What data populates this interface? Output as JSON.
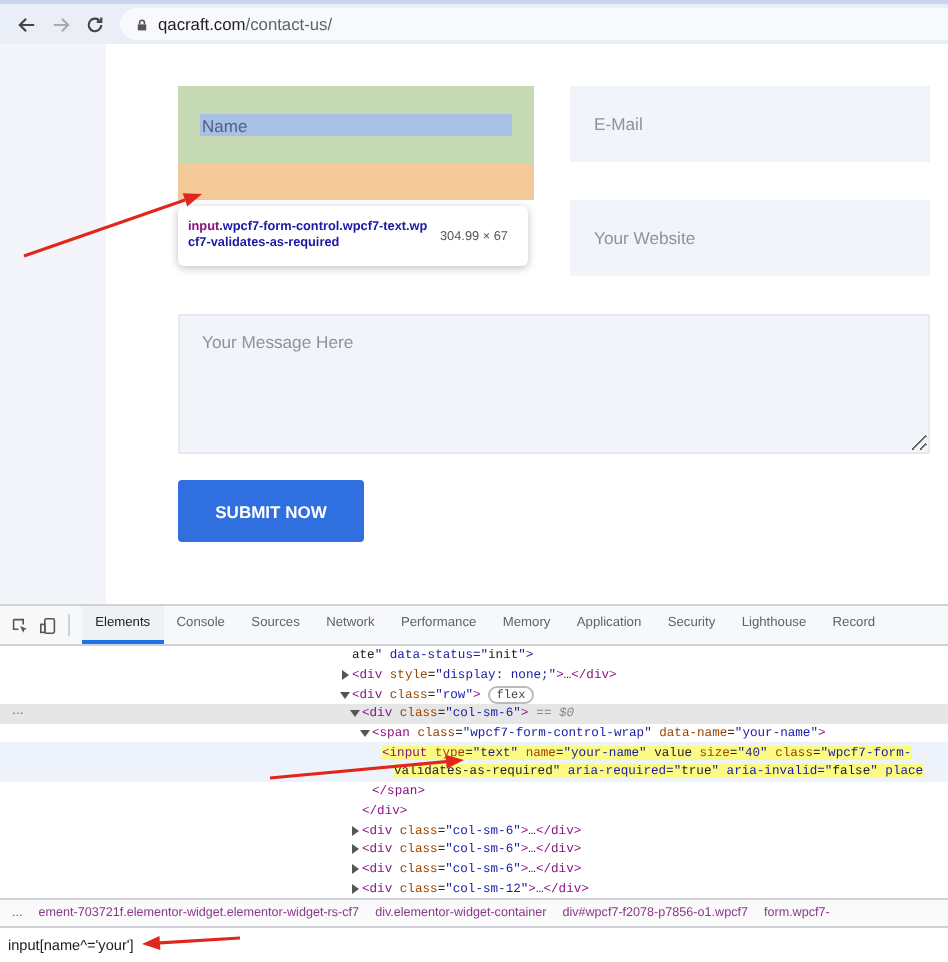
{
  "browser": {
    "url_host": "qacraft.com",
    "url_path": "/contact-us/"
  },
  "form": {
    "name": {
      "placeholder": "Name"
    },
    "tooltip": {
      "tag": "input",
      "classes": ".wpcf7-form-control.wpcf7-text.wpcf7-validates-as-required",
      "size": "304.99 × 67"
    },
    "email": {
      "placeholder": "E-Mail"
    },
    "website": {
      "placeholder": "Your Website"
    },
    "message": {
      "placeholder": "Your Message Here"
    },
    "submit": "SUBMIT NOW"
  },
  "devtools": {
    "tabs": [
      {
        "label": "Elements",
        "selected": true
      },
      {
        "label": "Console",
        "selected": false
      },
      {
        "label": "Sources",
        "selected": false
      },
      {
        "label": "Network",
        "selected": false
      },
      {
        "label": "Performance",
        "selected": false
      },
      {
        "label": "Memory",
        "selected": false
      },
      {
        "label": "Application",
        "selected": false
      },
      {
        "label": "Security",
        "selected": false
      },
      {
        "label": "Lighthouse",
        "selected": false
      },
      {
        "label": "Record",
        "selected": false
      }
    ],
    "tree": [
      {
        "lines": [
          "ate\" data-status=\"init\">"
        ],
        "selected": false,
        "highlighted": false
      },
      {
        "lines": [
          "<div style=\"display: none;\">…</div>"
        ],
        "expanded": false,
        "selected": false,
        "highlighted": false
      },
      {
        "lines": [
          "<div class=\"row\">"
        ],
        "badge": "flex",
        "expanded": true,
        "selected": false,
        "highlighted": false,
        "children": [
          {
            "lines": [
              "<div class=\"col-sm-6\">"
            ],
            "suffix": "== $0",
            "gutter": "...",
            "expanded": true,
            "selected": true,
            "highlighted": false,
            "close": "</div>",
            "children": [
              {
                "lines": [
                  "<span class=\"wpcf7-form-control-wrap\" data-name=\"your-name\">"
                ],
                "expanded": true,
                "selected": false,
                "highlighted": false,
                "close": "</span>",
                "children": [
                  {
                    "lines": [
                      "<input type=\"text\" name=\"your-name\" value size=\"40\" class=\"wpcf7-form-",
                      "validates-as-required\" aria-required=\"true\" aria-invalid=\"false\" place"
                    ],
                    "selected": false,
                    "highlighted": true
                  }
                ]
              }
            ]
          },
          {
            "lines": [
              "<div class=\"col-sm-6\">…</div>"
            ],
            "expanded": false,
            "selected": false,
            "highlighted": false
          },
          {
            "lines": [
              "<div class=\"col-sm-6\">…</div>"
            ],
            "expanded": false,
            "selected": false,
            "highlighted": false
          },
          {
            "lines": [
              "<div class=\"col-sm-6\">…</div>"
            ],
            "expanded": false,
            "selected": false,
            "highlighted": false
          },
          {
            "lines": [
              "<div class=\"col-sm-12\">…</div>"
            ],
            "expanded": false,
            "selected": false,
            "highlighted": false
          }
        ]
      }
    ],
    "breadcrumbs": {
      "overflow": "...",
      "items": [
        "ement-703721f.elementor-widget.elementor-widget-rs-cf7",
        "div.elementor-widget-container",
        "div#wpcf7-f2078-p7856-o1.wpcf7",
        "form.wpcf7-"
      ]
    },
    "search": {
      "value": "input[name^='your']"
    }
  }
}
